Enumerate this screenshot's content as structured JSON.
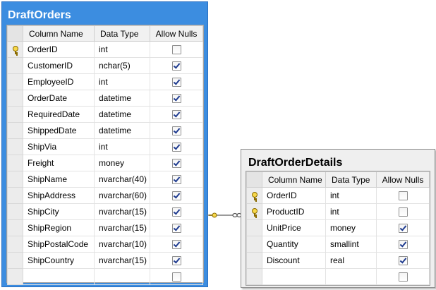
{
  "tables": [
    {
      "id": "t1",
      "title": "DraftOrders",
      "headers": {
        "column_name": "Column Name",
        "data_type": "Data Type",
        "allow_nulls": "Allow Nulls"
      },
      "rows": [
        {
          "name": "OrderID",
          "type": "int",
          "nulls": false,
          "pk": true
        },
        {
          "name": "CustomerID",
          "type": "nchar(5)",
          "nulls": true,
          "pk": false
        },
        {
          "name": "EmployeeID",
          "type": "int",
          "nulls": true,
          "pk": false
        },
        {
          "name": "OrderDate",
          "type": "datetime",
          "nulls": true,
          "pk": false
        },
        {
          "name": "RequiredDate",
          "type": "datetime",
          "nulls": true,
          "pk": false
        },
        {
          "name": "ShippedDate",
          "type": "datetime",
          "nulls": true,
          "pk": false
        },
        {
          "name": "ShipVia",
          "type": "int",
          "nulls": true,
          "pk": false
        },
        {
          "name": "Freight",
          "type": "money",
          "nulls": true,
          "pk": false
        },
        {
          "name": "ShipName",
          "type": "nvarchar(40)",
          "nulls": true,
          "pk": false
        },
        {
          "name": "ShipAddress",
          "type": "nvarchar(60)",
          "nulls": true,
          "pk": false
        },
        {
          "name": "ShipCity",
          "type": "nvarchar(15)",
          "nulls": true,
          "pk": false
        },
        {
          "name": "ShipRegion",
          "type": "nvarchar(15)",
          "nulls": true,
          "pk": false
        },
        {
          "name": "ShipPostalCode",
          "type": "nvarchar(10)",
          "nulls": true,
          "pk": false
        },
        {
          "name": "ShipCountry",
          "type": "nvarchar(15)",
          "nulls": true,
          "pk": false
        },
        {
          "name": "",
          "type": "",
          "nulls": false,
          "pk": false
        }
      ]
    },
    {
      "id": "t2",
      "title": "DraftOrderDetails",
      "headers": {
        "column_name": "Column Name",
        "data_type": "Data Type",
        "allow_nulls": "Allow Nulls"
      },
      "rows": [
        {
          "name": "OrderID",
          "type": "int",
          "nulls": false,
          "pk": true
        },
        {
          "name": "ProductID",
          "type": "int",
          "nulls": false,
          "pk": true
        },
        {
          "name": "UnitPrice",
          "type": "money",
          "nulls": true,
          "pk": false
        },
        {
          "name": "Quantity",
          "type": "smallint",
          "nulls": true,
          "pk": false
        },
        {
          "name": "Discount",
          "type": "real",
          "nulls": true,
          "pk": false
        },
        {
          "name": "",
          "type": "",
          "nulls": false,
          "pk": false
        }
      ]
    }
  ],
  "relationship": {
    "from": "DraftOrderDetails",
    "to": "DraftOrders",
    "one_end_icon": "key-icon",
    "many_end_icon": "infinity-icon"
  },
  "colors": {
    "selected_title_bar": "#3c8de0",
    "unselected_title_bar": "#efefef"
  }
}
